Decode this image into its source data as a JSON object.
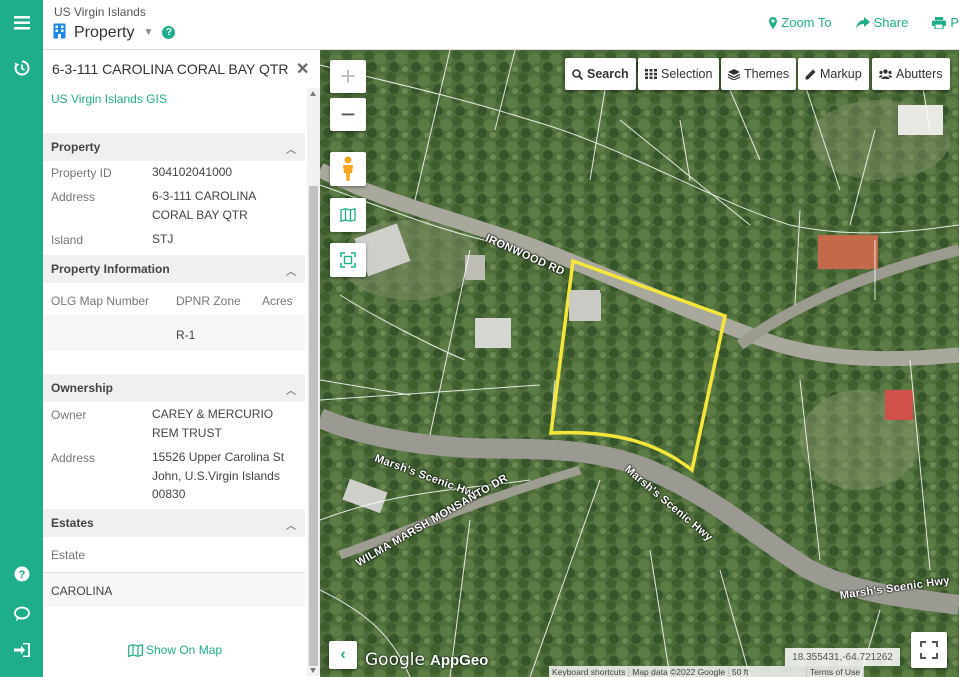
{
  "header": {
    "subtitle": "US Virgin Islands",
    "title": "Property",
    "actions": {
      "zoom_to": "Zoom To",
      "share": "Share",
      "print": "P"
    }
  },
  "panel": {
    "title": "6-3-111 CAROLINA CORAL BAY QTR",
    "source_link": "US Virgin Islands GIS",
    "property": {
      "header": "Property",
      "fields": [
        {
          "label": "Property ID",
          "value": "304102041000"
        },
        {
          "label": "Address",
          "value": "6-3-111 CAROLINA CORAL BAY QTR"
        },
        {
          "label": "Island",
          "value": "STJ"
        }
      ]
    },
    "property_information": {
      "header": "Property Information",
      "columns": [
        "OLG Map Number",
        "DPNR Zone",
        "Acres"
      ],
      "rows": [
        [
          "",
          "R-1",
          ""
        ]
      ]
    },
    "ownership": {
      "header": "Ownership",
      "fields": [
        {
          "label": "Owner",
          "value": "CAREY & MERCURIO REM TRUST"
        },
        {
          "label": "Address",
          "value": "15526 Upper Carolina St John, U.S.Virgin Islands 00830"
        }
      ]
    },
    "estates": {
      "header": "Estates",
      "column": "Estate",
      "value": "CAROLINA"
    },
    "show_on_map": "Show On Map"
  },
  "map": {
    "tools": {
      "search": "Search",
      "selection": "Selection",
      "themes": "Themes",
      "markup": "Markup",
      "abutters": "Abutters"
    },
    "roads": {
      "ironwood": "IRONWOOD RD",
      "marsh_1": "Marsh's Scenic Hwy",
      "marsh_2": "Marsh's Scenic Hwy",
      "marsh_3": "Marsh's Scenic Hwy",
      "monsanto": "WILMA MARSH MONSANTO DR"
    },
    "coordinates": "18.355431,-64.721262",
    "google": "Google",
    "appgeo": "AppGeo",
    "attribution": {
      "shortcuts": "Keyboard shortcuts",
      "map_data": "Map data ©2022 Google",
      "scale": "50 ft",
      "terms": "Terms of Use"
    },
    "colors": {
      "parcel_outline": "#f5e63a",
      "parcel_lines": "#ffffff",
      "accent": "#1fae8b"
    }
  }
}
